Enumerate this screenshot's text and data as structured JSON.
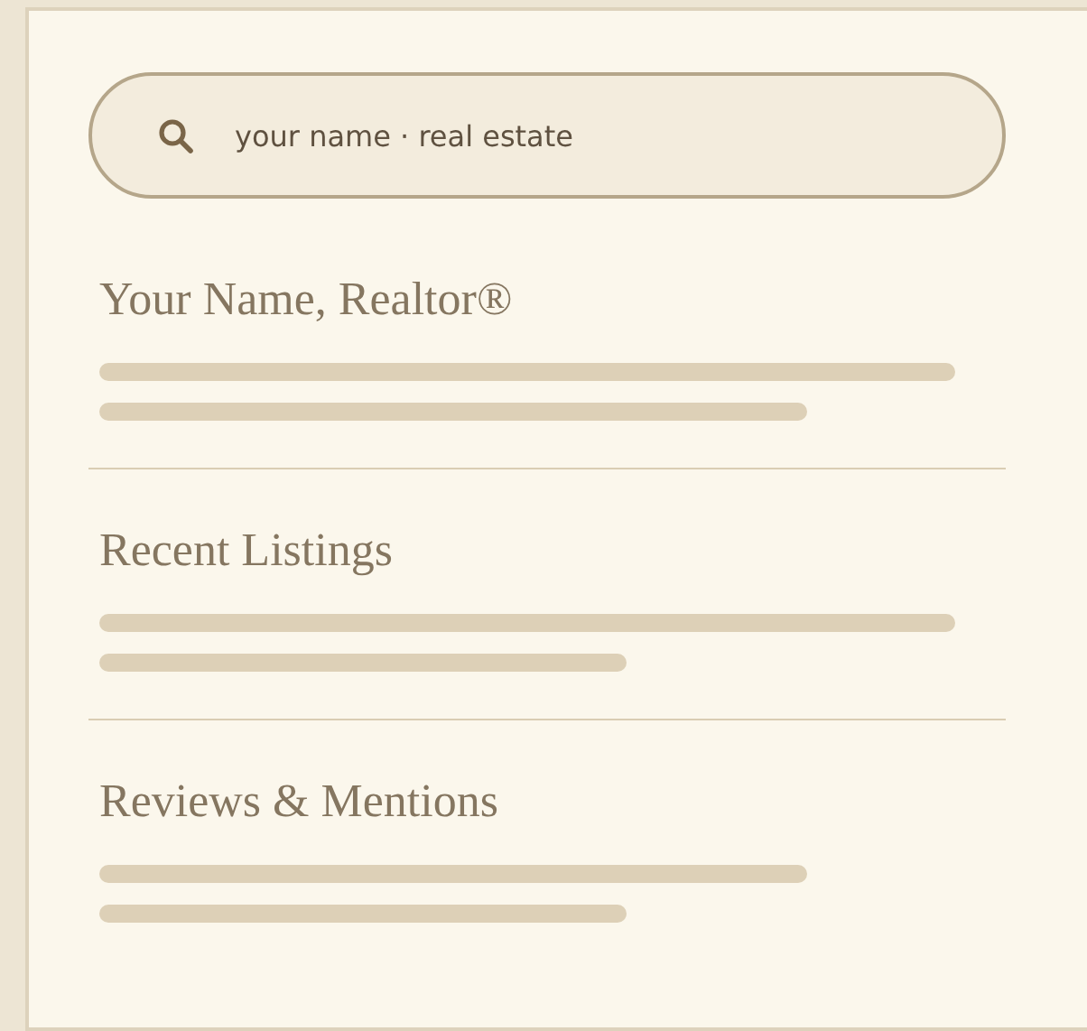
{
  "search": {
    "value": "your name · real estate"
  },
  "sections": [
    {
      "title": "Your Name, Realtor®",
      "lines": [
        {
          "kind": "long"
        },
        {
          "kind": "medium"
        }
      ]
    },
    {
      "title": "Recent Listings",
      "lines": [
        {
          "kind": "long"
        },
        {
          "kind": "short"
        }
      ]
    },
    {
      "title": "Reviews & Mentions",
      "lines": [
        {
          "kind": "medium"
        },
        {
          "kind": "short"
        }
      ]
    }
  ]
}
